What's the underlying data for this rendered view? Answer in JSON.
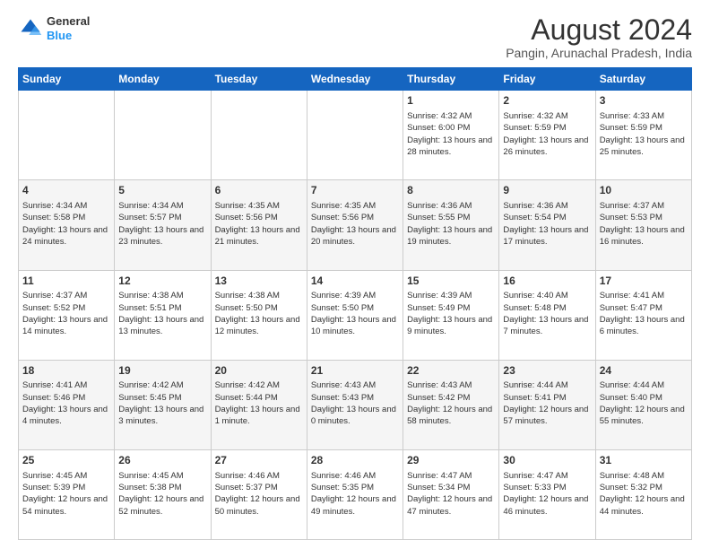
{
  "header": {
    "logo_general": "General",
    "logo_blue": "Blue",
    "month_year": "August 2024",
    "location": "Pangin, Arunachal Pradesh, India"
  },
  "days_of_week": [
    "Sunday",
    "Monday",
    "Tuesday",
    "Wednesday",
    "Thursday",
    "Friday",
    "Saturday"
  ],
  "weeks": [
    [
      {
        "day": "",
        "sunrise": "",
        "sunset": "",
        "daylight": ""
      },
      {
        "day": "",
        "sunrise": "",
        "sunset": "",
        "daylight": ""
      },
      {
        "day": "",
        "sunrise": "",
        "sunset": "",
        "daylight": ""
      },
      {
        "day": "",
        "sunrise": "",
        "sunset": "",
        "daylight": ""
      },
      {
        "day": "1",
        "sunrise": "Sunrise: 4:32 AM",
        "sunset": "Sunset: 6:00 PM",
        "daylight": "Daylight: 13 hours and 28 minutes."
      },
      {
        "day": "2",
        "sunrise": "Sunrise: 4:32 AM",
        "sunset": "Sunset: 5:59 PM",
        "daylight": "Daylight: 13 hours and 26 minutes."
      },
      {
        "day": "3",
        "sunrise": "Sunrise: 4:33 AM",
        "sunset": "Sunset: 5:59 PM",
        "daylight": "Daylight: 13 hours and 25 minutes."
      }
    ],
    [
      {
        "day": "4",
        "sunrise": "Sunrise: 4:34 AM",
        "sunset": "Sunset: 5:58 PM",
        "daylight": "Daylight: 13 hours and 24 minutes."
      },
      {
        "day": "5",
        "sunrise": "Sunrise: 4:34 AM",
        "sunset": "Sunset: 5:57 PM",
        "daylight": "Daylight: 13 hours and 23 minutes."
      },
      {
        "day": "6",
        "sunrise": "Sunrise: 4:35 AM",
        "sunset": "Sunset: 5:56 PM",
        "daylight": "Daylight: 13 hours and 21 minutes."
      },
      {
        "day": "7",
        "sunrise": "Sunrise: 4:35 AM",
        "sunset": "Sunset: 5:56 PM",
        "daylight": "Daylight: 13 hours and 20 minutes."
      },
      {
        "day": "8",
        "sunrise": "Sunrise: 4:36 AM",
        "sunset": "Sunset: 5:55 PM",
        "daylight": "Daylight: 13 hours and 19 minutes."
      },
      {
        "day": "9",
        "sunrise": "Sunrise: 4:36 AM",
        "sunset": "Sunset: 5:54 PM",
        "daylight": "Daylight: 13 hours and 17 minutes."
      },
      {
        "day": "10",
        "sunrise": "Sunrise: 4:37 AM",
        "sunset": "Sunset: 5:53 PM",
        "daylight": "Daylight: 13 hours and 16 minutes."
      }
    ],
    [
      {
        "day": "11",
        "sunrise": "Sunrise: 4:37 AM",
        "sunset": "Sunset: 5:52 PM",
        "daylight": "Daylight: 13 hours and 14 minutes."
      },
      {
        "day": "12",
        "sunrise": "Sunrise: 4:38 AM",
        "sunset": "Sunset: 5:51 PM",
        "daylight": "Daylight: 13 hours and 13 minutes."
      },
      {
        "day": "13",
        "sunrise": "Sunrise: 4:38 AM",
        "sunset": "Sunset: 5:50 PM",
        "daylight": "Daylight: 13 hours and 12 minutes."
      },
      {
        "day": "14",
        "sunrise": "Sunrise: 4:39 AM",
        "sunset": "Sunset: 5:50 PM",
        "daylight": "Daylight: 13 hours and 10 minutes."
      },
      {
        "day": "15",
        "sunrise": "Sunrise: 4:39 AM",
        "sunset": "Sunset: 5:49 PM",
        "daylight": "Daylight: 13 hours and 9 minutes."
      },
      {
        "day": "16",
        "sunrise": "Sunrise: 4:40 AM",
        "sunset": "Sunset: 5:48 PM",
        "daylight": "Daylight: 13 hours and 7 minutes."
      },
      {
        "day": "17",
        "sunrise": "Sunrise: 4:41 AM",
        "sunset": "Sunset: 5:47 PM",
        "daylight": "Daylight: 13 hours and 6 minutes."
      }
    ],
    [
      {
        "day": "18",
        "sunrise": "Sunrise: 4:41 AM",
        "sunset": "Sunset: 5:46 PM",
        "daylight": "Daylight: 13 hours and 4 minutes."
      },
      {
        "day": "19",
        "sunrise": "Sunrise: 4:42 AM",
        "sunset": "Sunset: 5:45 PM",
        "daylight": "Daylight: 13 hours and 3 minutes."
      },
      {
        "day": "20",
        "sunrise": "Sunrise: 4:42 AM",
        "sunset": "Sunset: 5:44 PM",
        "daylight": "Daylight: 13 hours and 1 minute."
      },
      {
        "day": "21",
        "sunrise": "Sunrise: 4:43 AM",
        "sunset": "Sunset: 5:43 PM",
        "daylight": "Daylight: 13 hours and 0 minutes."
      },
      {
        "day": "22",
        "sunrise": "Sunrise: 4:43 AM",
        "sunset": "Sunset: 5:42 PM",
        "daylight": "Daylight: 12 hours and 58 minutes."
      },
      {
        "day": "23",
        "sunrise": "Sunrise: 4:44 AM",
        "sunset": "Sunset: 5:41 PM",
        "daylight": "Daylight: 12 hours and 57 minutes."
      },
      {
        "day": "24",
        "sunrise": "Sunrise: 4:44 AM",
        "sunset": "Sunset: 5:40 PM",
        "daylight": "Daylight: 12 hours and 55 minutes."
      }
    ],
    [
      {
        "day": "25",
        "sunrise": "Sunrise: 4:45 AM",
        "sunset": "Sunset: 5:39 PM",
        "daylight": "Daylight: 12 hours and 54 minutes."
      },
      {
        "day": "26",
        "sunrise": "Sunrise: 4:45 AM",
        "sunset": "Sunset: 5:38 PM",
        "daylight": "Daylight: 12 hours and 52 minutes."
      },
      {
        "day": "27",
        "sunrise": "Sunrise: 4:46 AM",
        "sunset": "Sunset: 5:37 PM",
        "daylight": "Daylight: 12 hours and 50 minutes."
      },
      {
        "day": "28",
        "sunrise": "Sunrise: 4:46 AM",
        "sunset": "Sunset: 5:35 PM",
        "daylight": "Daylight: 12 hours and 49 minutes."
      },
      {
        "day": "29",
        "sunrise": "Sunrise: 4:47 AM",
        "sunset": "Sunset: 5:34 PM",
        "daylight": "Daylight: 12 hours and 47 minutes."
      },
      {
        "day": "30",
        "sunrise": "Sunrise: 4:47 AM",
        "sunset": "Sunset: 5:33 PM",
        "daylight": "Daylight: 12 hours and 46 minutes."
      },
      {
        "day": "31",
        "sunrise": "Sunrise: 4:48 AM",
        "sunset": "Sunset: 5:32 PM",
        "daylight": "Daylight: 12 hours and 44 minutes."
      }
    ]
  ]
}
